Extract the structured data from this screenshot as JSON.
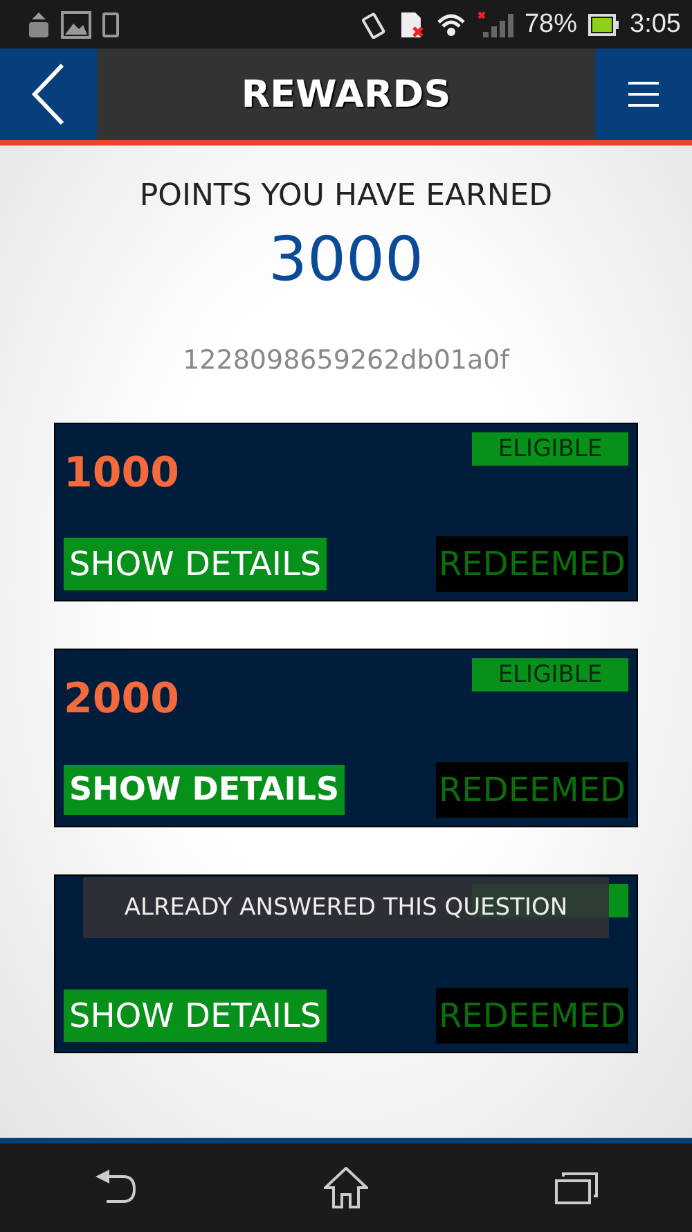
{
  "status_bar": {
    "battery": "78%",
    "time": "3:05"
  },
  "header": {
    "title": "REWARDS"
  },
  "points": {
    "label": "POINTS YOU HAVE EARNED",
    "value": "3000",
    "code": "1228098659262db01a0f"
  },
  "rewards": [
    {
      "amount": "1000",
      "badge": "ELIGIBLE",
      "button": "SHOW DETAILS",
      "pressed": false,
      "status": "REDEEMED"
    },
    {
      "amount": "2000",
      "badge": "ELIGIBLE",
      "button": "SHOW DETAILS",
      "pressed": true,
      "status": "REDEEMED"
    },
    {
      "button": "SHOW DETAILS",
      "pressed": false,
      "status": "REDEEMED"
    }
  ],
  "toast": {
    "text": "ALREADY ANSWERED THIS QUESTION"
  }
}
